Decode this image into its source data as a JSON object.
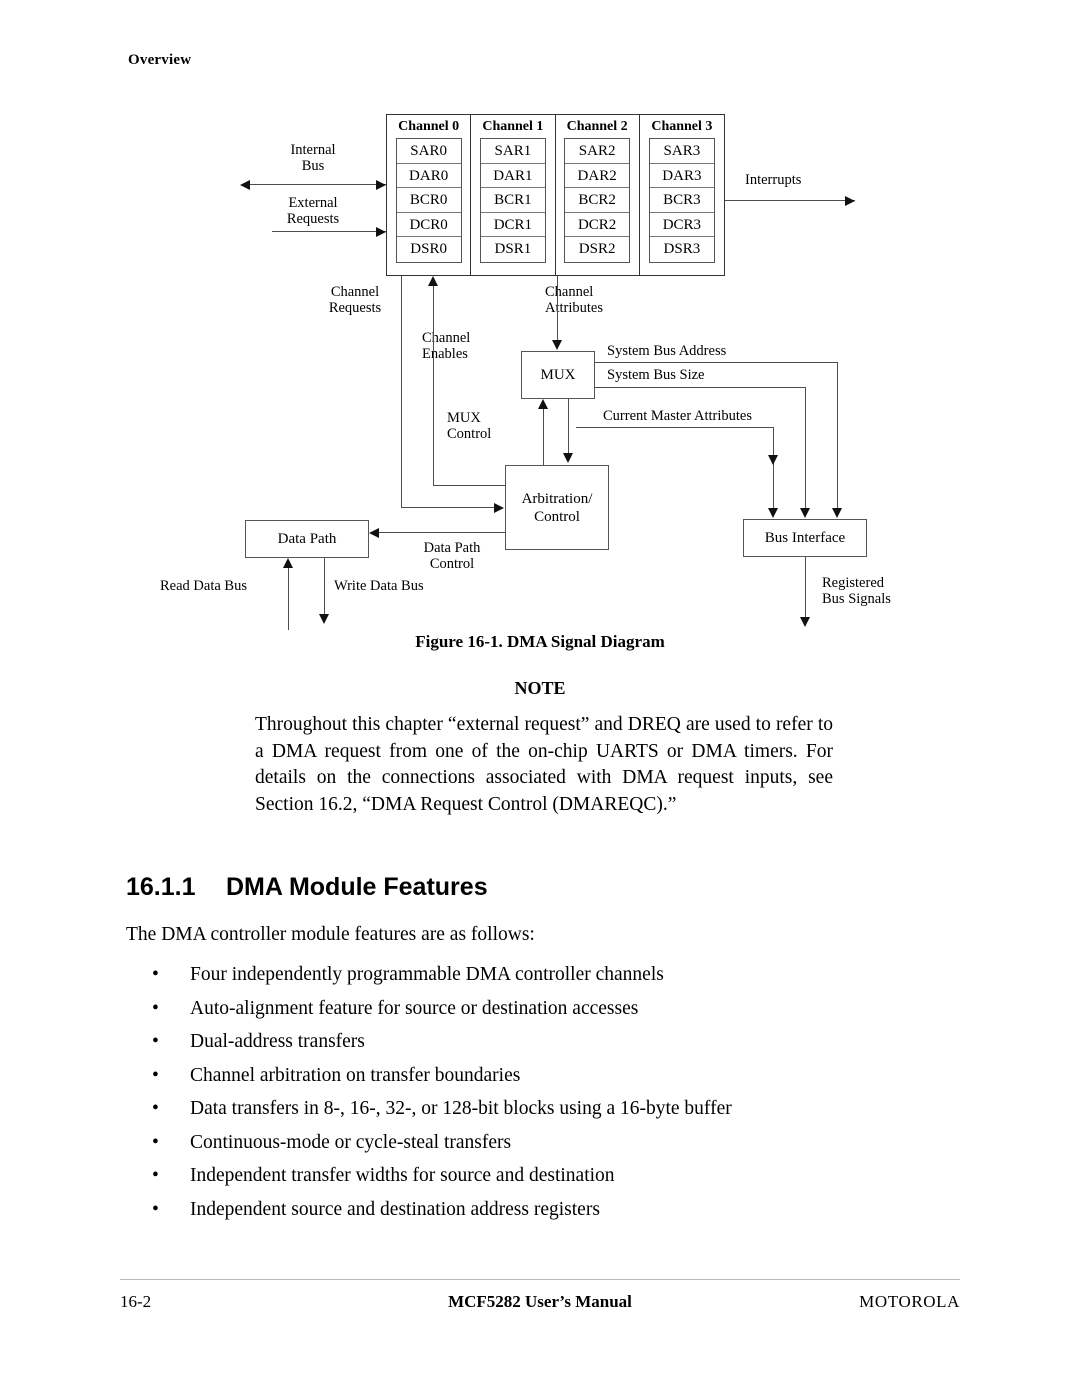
{
  "running_head": "Overview",
  "figure": {
    "caption": "Figure 16-1. DMA Signal Diagram",
    "channels": [
      {
        "title": "Channel 0",
        "registers": [
          "SAR0",
          "DAR0",
          "BCR0",
          "DCR0",
          "DSR0"
        ]
      },
      {
        "title": "Channel 1",
        "registers": [
          "SAR1",
          "DAR1",
          "BCR1",
          "DCR1",
          "DSR1"
        ]
      },
      {
        "title": "Channel 2",
        "registers": [
          "SAR2",
          "DAR2",
          "BCR2",
          "DCR2",
          "DSR2"
        ]
      },
      {
        "title": "Channel 3",
        "registers": [
          "SAR3",
          "DAR3",
          "BCR3",
          "DCR3",
          "DSR3"
        ]
      }
    ],
    "boxes": {
      "mux": "MUX",
      "arbitration": "Arbitration/\nControl",
      "data_path": "Data Path",
      "bus_interface": "Bus Interface"
    },
    "labels": {
      "internal_bus": "Internal\nBus",
      "external_requests": "External\nRequests",
      "interrupts": "Interrupts",
      "channel_requests": "Channel\nRequests",
      "channel_attributes": "Channel\nAttributes",
      "channel_enables": "Channel\nEnables",
      "mux_control": "MUX\nControl",
      "system_bus_address": "System Bus Address",
      "system_bus_size": "System Bus Size",
      "current_master_attributes": "Current Master Attributes",
      "data_path_control": "Data Path\nControl",
      "read_data_bus": "Read Data Bus",
      "write_data_bus": "Write Data Bus",
      "registered_bus_signals": "Registered\nBus Signals"
    }
  },
  "note": {
    "heading": "NOTE",
    "body": "Throughout this chapter “external request” and DREQ are used to refer to a DMA request from one of the on-chip UARTS or DMA timers. For details on the connections associated with DMA request inputs, see Section 16.2, “DMA Request Control (DMAREQC).”"
  },
  "section": {
    "number": "16.1.1",
    "title": "DMA Module Features",
    "intro": "The DMA controller module features are as follows:",
    "bullet_marker": "•",
    "features": [
      "Four independently programmable DMA controller channels",
      "Auto-alignment feature for source or destination accesses",
      "Dual-address transfers",
      "Channel arbitration on transfer boundaries",
      "Data transfers in 8-, 16-, 32-, or 128-bit blocks using a 16-byte buffer",
      "Continuous-mode or cycle-steal transfers",
      "Independent transfer widths for source and destination",
      "Independent source and destination address registers"
    ]
  },
  "footer": {
    "page_number": "16-2",
    "document_title": "MCF5282 User’s Manual",
    "brand": "MOTOROLA"
  }
}
